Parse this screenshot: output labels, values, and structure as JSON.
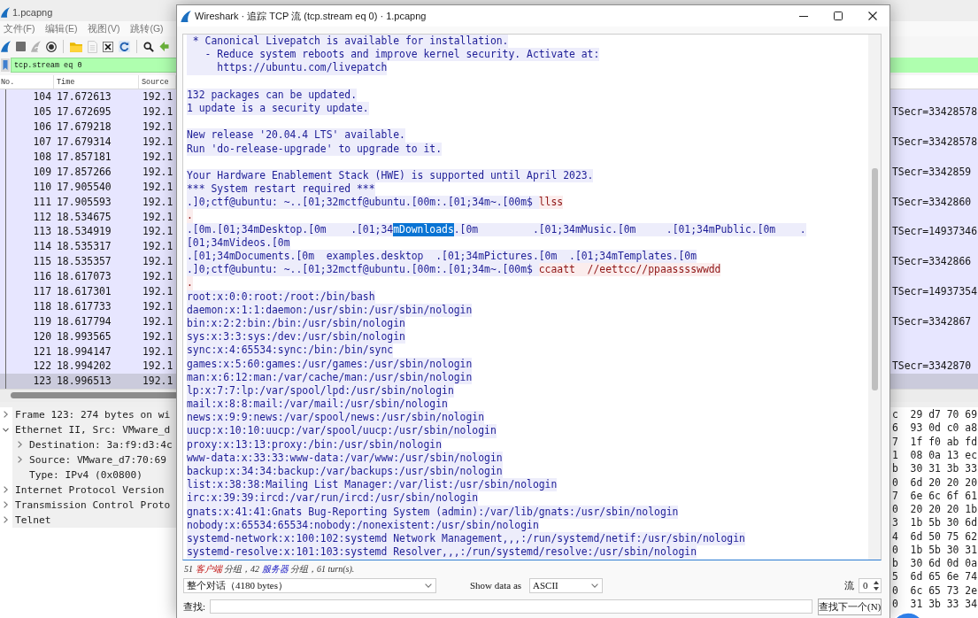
{
  "main_window": {
    "title": "1.pcapng",
    "menu": [
      "文件(F)",
      "编辑(E)",
      "视图(V)",
      "跳转(G)"
    ],
    "toolbar": [
      {
        "kind": "start",
        "disabled": false
      },
      {
        "kind": "stop",
        "disabled": false
      },
      {
        "kind": "restart",
        "disabled": true
      },
      {
        "kind": "options",
        "disabled": false
      },
      {
        "kind": "separator"
      },
      {
        "kind": "open",
        "disabled": false
      },
      {
        "kind": "file",
        "disabled": true
      },
      {
        "kind": "close",
        "disabled": false
      },
      {
        "kind": "reload",
        "disabled": false
      },
      {
        "kind": "separator"
      },
      {
        "kind": "find",
        "disabled": false
      },
      {
        "kind": "back",
        "disabled": false
      }
    ],
    "filter": {
      "value": "tcp.stream eq 0"
    },
    "packet_list": {
      "columns": [
        "No.",
        "Time",
        "Source"
      ],
      "rows": [
        {
          "no": "104",
          "time": "17.672613",
          "source": "192.1",
          "selected": false
        },
        {
          "no": "105",
          "time": "17.672695",
          "source": "192.1",
          "last_column": "TSecr=33428578",
          "selected": false
        },
        {
          "no": "106",
          "time": "17.679218",
          "source": "192.1",
          "selected": false
        },
        {
          "no": "107",
          "time": "17.679314",
          "source": "192.1",
          "last_column": "TSecr=33428578",
          "selected": false
        },
        {
          "no": "108",
          "time": "17.857181",
          "source": "192.1",
          "selected": false
        },
        {
          "no": "109",
          "time": "17.857266",
          "source": "192.1",
          "last_column": "TSecr=3342859",
          "selected": false
        },
        {
          "no": "110",
          "time": "17.905540",
          "source": "192.1",
          "selected": false
        },
        {
          "no": "111",
          "time": "17.905593",
          "source": "192.1",
          "last_column": "TSecr=3342860",
          "selected": false
        },
        {
          "no": "112",
          "time": "18.534675",
          "source": "192.1",
          "selected": false
        },
        {
          "no": "113",
          "time": "18.534919",
          "source": "192.1",
          "last_column": "TSecr=14937346",
          "selected": false
        },
        {
          "no": "114",
          "time": "18.535317",
          "source": "192.1",
          "selected": false
        },
        {
          "no": "115",
          "time": "18.535357",
          "source": "192.1",
          "last_column": "TSecr=3342866",
          "selected": false
        },
        {
          "no": "116",
          "time": "18.617073",
          "source": "192.1",
          "selected": false
        },
        {
          "no": "117",
          "time": "18.617301",
          "source": "192.1",
          "last_column": "TSecr=14937354",
          "selected": false
        },
        {
          "no": "118",
          "time": "18.617733",
          "source": "192.1",
          "selected": false
        },
        {
          "no": "119",
          "time": "18.617794",
          "source": "192.1",
          "last_column": "TSecr=3342867",
          "selected": false
        },
        {
          "no": "120",
          "time": "18.993565",
          "source": "192.1",
          "selected": false
        },
        {
          "no": "121",
          "time": "18.994147",
          "source": "192.1",
          "selected": false
        },
        {
          "no": "122",
          "time": "18.994202",
          "source": "192.1",
          "last_column": "TSecr=3342870",
          "selected": false
        },
        {
          "no": "123",
          "time": "18.996513",
          "source": "192.1",
          "selected": true
        }
      ]
    },
    "packet_details": [
      {
        "kind": "branch",
        "text": "Frame 123: 274 bytes on wi",
        "expanded": false
      },
      {
        "kind": "branch",
        "text": "Ethernet II, Src: VMware_d",
        "expanded": true,
        "children": [
          {
            "kind": "branch",
            "text": "Destination: 3a:f9:d3:4c",
            "expanded": false
          },
          {
            "kind": "branch",
            "text": "Source: VMware_d7:70:69",
            "expanded": false
          },
          {
            "kind": "leaf",
            "text": "Type: IPv4 (0x0800)"
          }
        ]
      },
      {
        "kind": "branch",
        "text": "Internet Protocol Version",
        "expanded": false
      },
      {
        "kind": "branch",
        "text": "Transmission Control Proto",
        "expanded": false
      },
      {
        "kind": "branch",
        "text": "Telnet",
        "expanded": false
      }
    ],
    "packet_bytes": [
      "c  29 d7 70 69",
      "6  93 0d c0 a8",
      "7  1f f0 ab fd",
      "1  08 0a 13 ec",
      "b  30 31 3b 33",
      "0  6d 20 20 20",
      "7  6e 6c 6f 61",
      "0  20 20 20 1b",
      "3  1b 5b 30 6d",
      "4  6d 50 75 62",
      "0  1b 5b 30 31",
      "b  30 6d 0d 0a",
      "5  6d 65 6e 74",
      "0  6c 65 73 2e",
      "0  31 3b 33 34"
    ]
  },
  "dialog": {
    "title": "Wireshark · 追踪 TCP 流 (tcp.stream eq 0) · 1.pcapng",
    "stream_lines": [
      {
        "kind": "text",
        "segments": [
          {
            "text": " * Canonical Livepatch is available for installation.",
            "kind": "server",
            "selected": false
          }
        ]
      },
      {
        "kind": "text",
        "segments": [
          {
            "text": "   - Reduce system reboots and improve kernel security. Activate at:",
            "kind": "server",
            "selected": false
          }
        ]
      },
      {
        "kind": "text",
        "segments": [
          {
            "text": "     https://ubuntu.com/livepatch",
            "kind": "server",
            "selected": false
          }
        ]
      },
      {
        "kind": "blank"
      },
      {
        "kind": "text",
        "segments": [
          {
            "text": "132 packages can be updated.",
            "kind": "server",
            "selected": false
          }
        ]
      },
      {
        "kind": "text",
        "segments": [
          {
            "text": "1 update is a security update.",
            "kind": "server",
            "selected": false
          }
        ]
      },
      {
        "kind": "blank"
      },
      {
        "kind": "text",
        "segments": [
          {
            "text": "New release '20.04.4 LTS' available.",
            "kind": "server",
            "selected": false
          }
        ]
      },
      {
        "kind": "text",
        "segments": [
          {
            "text": "Run 'do-release-upgrade' to upgrade to it.",
            "kind": "server",
            "selected": false
          }
        ]
      },
      {
        "kind": "blank"
      },
      {
        "kind": "text",
        "segments": [
          {
            "text": "Your Hardware Enablement Stack (HWE) is supported until April 2023.",
            "kind": "server",
            "selected": false
          }
        ]
      },
      {
        "kind": "text",
        "segments": [
          {
            "text": "*** System restart required ***",
            "kind": "server",
            "selected": false
          }
        ]
      },
      {
        "kind": "text",
        "segments": [
          {
            "text": ".]0;ctf@ubuntu: ~..[01;32mctf@ubuntu.[00m:.[01;34m~.[00m$ ",
            "kind": "server",
            "selected": false
          },
          {
            "text": "llss",
            "kind": "client",
            "selected": false
          }
        ]
      },
      {
        "kind": "text",
        "segments": [
          {
            "text": ".",
            "kind": "client",
            "selected": false
          }
        ]
      },
      {
        "kind": "text",
        "segments": [
          {
            "text": ".[0m.[01;34mDesktop.[0m    .[01;34",
            "kind": "server",
            "selected": false
          },
          {
            "text": "mDownloads",
            "kind": "server",
            "selected": true
          },
          {
            "text": ".[0m         .[01;34mMusic.[0m     .[01;34mPublic.[0m    .",
            "kind": "server",
            "selected": false
          }
        ]
      },
      {
        "kind": "text",
        "segments": [
          {
            "text": "[01;34mVideos.[0m",
            "kind": "server",
            "selected": false
          }
        ]
      },
      {
        "kind": "text",
        "segments": [
          {
            "text": ".[01;34mDocuments.[0m  examples.desktop  .[01;34mPictures.[0m  .[01;34mTemplates.[0m",
            "kind": "server",
            "selected": false
          }
        ]
      },
      {
        "kind": "text",
        "segments": [
          {
            "text": ".]0;ctf@ubuntu: ~..[01;32mctf@ubuntu.[00m:.[01;34m~.[00m$ ",
            "kind": "server",
            "selected": false
          },
          {
            "text": "ccaatt  //eettcc//ppaasssswwdd",
            "kind": "client",
            "selected": false
          }
        ]
      },
      {
        "kind": "text",
        "segments": [
          {
            "text": ".",
            "kind": "client",
            "selected": false
          }
        ]
      },
      {
        "kind": "text",
        "segments": [
          {
            "text": "root:x:0:0:root:/root:/bin/bash",
            "kind": "server",
            "selected": false
          }
        ]
      },
      {
        "kind": "text",
        "segments": [
          {
            "text": "daemon:x:1:1:daemon:/usr/sbin:/usr/sbin/nologin",
            "kind": "server",
            "selected": false
          }
        ]
      },
      {
        "kind": "text",
        "segments": [
          {
            "text": "bin:x:2:2:bin:/bin:/usr/sbin/nologin",
            "kind": "server",
            "selected": false
          }
        ]
      },
      {
        "kind": "text",
        "segments": [
          {
            "text": "sys:x:3:3:sys:/dev:/usr/sbin/nologin",
            "kind": "server",
            "selected": false
          }
        ]
      },
      {
        "kind": "text",
        "segments": [
          {
            "text": "sync:x:4:65534:sync:/bin:/bin/sync",
            "kind": "server",
            "selected": false
          }
        ]
      },
      {
        "kind": "text",
        "segments": [
          {
            "text": "games:x:5:60:games:/usr/games:/usr/sbin/nologin",
            "kind": "server",
            "selected": false
          }
        ]
      },
      {
        "kind": "text",
        "segments": [
          {
            "text": "man:x:6:12:man:/var/cache/man:/usr/sbin/nologin",
            "kind": "server",
            "selected": false
          }
        ]
      },
      {
        "kind": "text",
        "segments": [
          {
            "text": "lp:x:7:7:lp:/var/spool/lpd:/usr/sbin/nologin",
            "kind": "server",
            "selected": false
          }
        ]
      },
      {
        "kind": "text",
        "segments": [
          {
            "text": "mail:x:8:8:mail:/var/mail:/usr/sbin/nologin",
            "kind": "server",
            "selected": false
          }
        ]
      },
      {
        "kind": "text",
        "segments": [
          {
            "text": "news:x:9:9:news:/var/spool/news:/usr/sbin/nologin",
            "kind": "server",
            "selected": false
          }
        ]
      },
      {
        "kind": "text",
        "segments": [
          {
            "text": "uucp:x:10:10:uucp:/var/spool/uucp:/usr/sbin/nologin",
            "kind": "server",
            "selected": false
          }
        ]
      },
      {
        "kind": "text",
        "segments": [
          {
            "text": "proxy:x:13:13:proxy:/bin:/usr/sbin/nologin",
            "kind": "server",
            "selected": false
          }
        ]
      },
      {
        "kind": "text",
        "segments": [
          {
            "text": "www-data:x:33:33:www-data:/var/www:/usr/sbin/nologin",
            "kind": "server",
            "selected": false
          }
        ]
      },
      {
        "kind": "text",
        "segments": [
          {
            "text": "backup:x:34:34:backup:/var/backups:/usr/sbin/nologin",
            "kind": "server",
            "selected": false
          }
        ]
      },
      {
        "kind": "text",
        "segments": [
          {
            "text": "list:x:38:38:Mailing List Manager:/var/list:/usr/sbin/nologin",
            "kind": "server",
            "selected": false
          }
        ]
      },
      {
        "kind": "text",
        "segments": [
          {
            "text": "irc:x:39:39:ircd:/var/run/ircd:/usr/sbin/nologin",
            "kind": "server",
            "selected": false
          }
        ]
      },
      {
        "kind": "text",
        "segments": [
          {
            "text": "gnats:x:41:41:Gnats Bug-Reporting System (admin):/var/lib/gnats:/usr/sbin/nologin",
            "kind": "server",
            "selected": false
          }
        ]
      },
      {
        "kind": "text",
        "segments": [
          {
            "text": "nobody:x:65534:65534:nobody:/nonexistent:/usr/sbin/nologin",
            "kind": "server",
            "selected": false
          }
        ]
      },
      {
        "kind": "text",
        "segments": [
          {
            "text": "systemd-network:x:100:102:systemd Network Management,,,:/run/systemd/netif:/usr/sbin/nologin",
            "kind": "server",
            "selected": false
          }
        ]
      },
      {
        "kind": "text",
        "segments": [
          {
            "text": "systemd-resolve:x:101:103:systemd Resolver,,,:/run/systemd/resolve:/usr/sbin/nologin",
            "kind": "server",
            "selected": false
          }
        ]
      }
    ],
    "summary": [
      {
        "text": "51 ",
        "kind": "plain"
      },
      {
        "text": "客户端",
        "kind": "client"
      },
      {
        "text": " 分组，42 ",
        "kind": "plain"
      },
      {
        "text": "服务器",
        "kind": "server"
      },
      {
        "text": " 分组，61 turn(s).",
        "kind": "plain"
      }
    ],
    "conversation_select": {
      "value": "整个对话（4180 bytes）"
    },
    "show_data_as": {
      "label": "Show data as",
      "value": "ASCII"
    },
    "stream": {
      "label": "流",
      "value": "0"
    },
    "find": {
      "label": "查找:"
    },
    "find_next_button": {
      "label": "查找下一个(N)"
    }
  }
}
